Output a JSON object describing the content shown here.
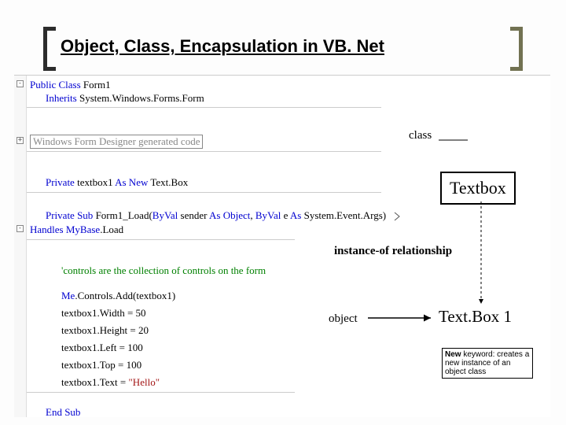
{
  "title": "Object, Class, Encapsulation in VB. Net",
  "code": {
    "l1a": "Public Class ",
    "l1b": "Form1",
    "l2a": "Inherits ",
    "l2b": "System.Windows.Forms.Form",
    "gen": "Windows Form Designer generated code",
    "l3a": "Private ",
    "l3b": "textbox1 ",
    "l3c": "As New ",
    "l3d": "Text.Box",
    "l4a": "Private Sub ",
    "l4b": "Form1_Load(",
    "l4c": "ByVal ",
    "l4d": "sender ",
    "l4e": "As Object",
    "l4f": ", ",
    "l4g": "ByVal ",
    "l4h": "e ",
    "l4i": "As ",
    "l4j": "System.Event.Args)",
    "l5a": "Handles ",
    "l5b": "MyBase",
    "l5c": ".Load",
    "comment": "'controls are the collection of controls on the form",
    "l6a": "Me",
    "l6b": ".Controls.Add(textbox1)",
    "l7": "textbox1.Width = 50",
    "l8": "textbox1.Height = 20",
    "l9": "textbox1.Left = 100",
    "l10": "textbox1.Top = 100",
    "l11a": "textbox1.Text = ",
    "l11b": "\"Hello\"",
    "l12": "End Sub"
  },
  "labels": {
    "class": "class",
    "textbox": "Textbox",
    "instance": "instance-of relationship",
    "object": "object",
    "textbox1": "Text.Box 1"
  },
  "note": {
    "kw": "New",
    "rest": " keyword: creates a new instance of an object class"
  }
}
